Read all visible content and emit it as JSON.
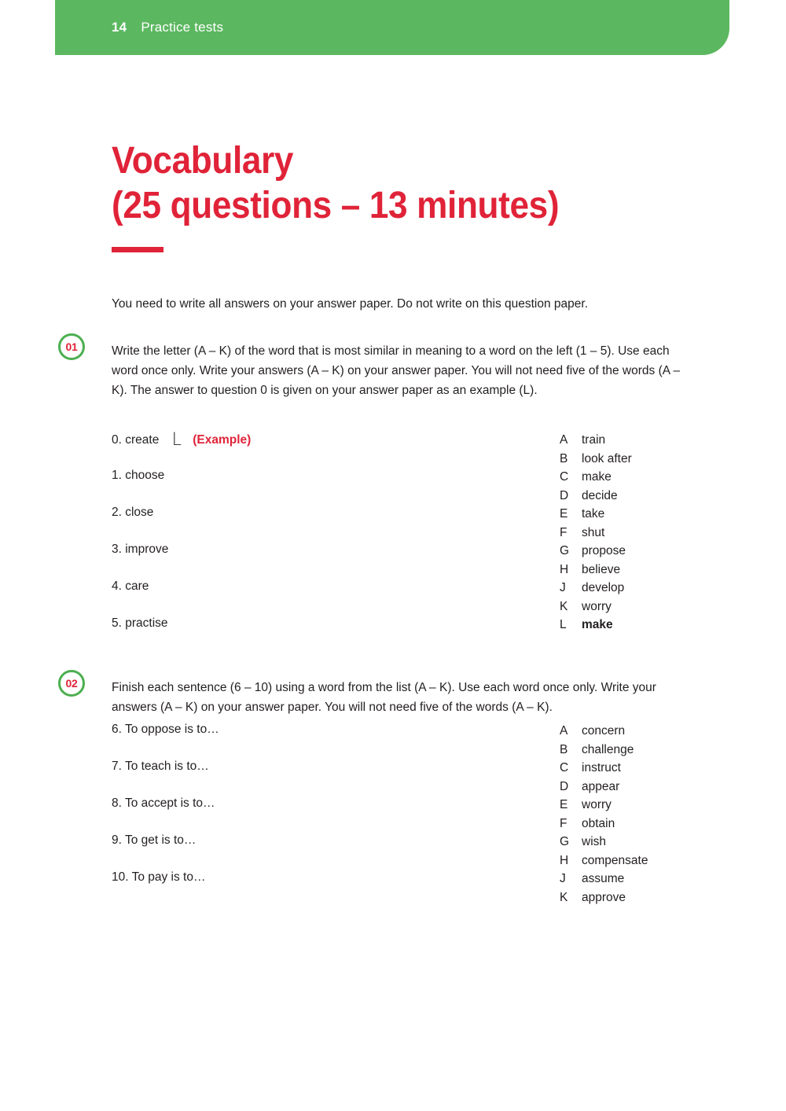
{
  "header": {
    "page_number": "14",
    "section_title": "Practice tests",
    "band_color": "#5cb860"
  },
  "title": {
    "line1": "Vocabulary",
    "line2": "(25 questions – 13 minutes)",
    "accent_color": "#e02338"
  },
  "instruction_note": "You need to write all answers on your answer paper. Do not write on this question paper.",
  "questions": [
    {
      "badge": "01",
      "prompt": "Write the letter (A – K) of the word that is most similar in meaning to a word on the left (1 – 5). Use each word once only. Write your answers (A – K) on your answer paper. You will not need five of the words (A – K). The answer to question 0 is given on your answer paper as an example (L).",
      "stems": [
        {
          "text": "0. create",
          "example_letter": "L",
          "example_tag": "(Example)"
        },
        {
          "text": "1. choose"
        },
        {
          "text": "2. close"
        },
        {
          "text": "3. improve"
        },
        {
          "text": "4. care"
        },
        {
          "text": "5. practise"
        }
      ],
      "options": [
        {
          "letter": "A",
          "word": "train",
          "bold": false
        },
        {
          "letter": "B",
          "word": "look after",
          "bold": false
        },
        {
          "letter": "C",
          "word": "make",
          "bold": false
        },
        {
          "letter": "D",
          "word": "decide",
          "bold": false
        },
        {
          "letter": "E",
          "word": "take",
          "bold": false
        },
        {
          "letter": "F",
          "word": "shut",
          "bold": false
        },
        {
          "letter": "G",
          "word": "propose",
          "bold": false
        },
        {
          "letter": "H",
          "word": "believe",
          "bold": false
        },
        {
          "letter": "J",
          "word": "develop",
          "bold": false
        },
        {
          "letter": "K",
          "word": "worry",
          "bold": false
        },
        {
          "letter": "L",
          "word": "make",
          "bold": true
        }
      ]
    },
    {
      "badge": "02",
      "prompt": "Finish each sentence (6 – 10) using a word from the list (A – K). Use each word once only. Write your answers (A – K) on your answer paper. You will not need five of the words (A – K).",
      "stems": [
        {
          "text": "6. To oppose is to…"
        },
        {
          "text": "7. To teach is to…"
        },
        {
          "text": "8. To accept is to…"
        },
        {
          "text": "9. To get is to…"
        },
        {
          "text": "10. To pay is to…"
        }
      ],
      "options": [
        {
          "letter": "A",
          "word": "concern",
          "bold": false
        },
        {
          "letter": "B",
          "word": "challenge",
          "bold": false
        },
        {
          "letter": "C",
          "word": "instruct",
          "bold": false
        },
        {
          "letter": "D",
          "word": "appear",
          "bold": false
        },
        {
          "letter": "E",
          "word": "worry",
          "bold": false
        },
        {
          "letter": "F",
          "word": "obtain",
          "bold": false
        },
        {
          "letter": "G",
          "word": "wish",
          "bold": false
        },
        {
          "letter": "H",
          "word": "compensate",
          "bold": false
        },
        {
          "letter": "J",
          "word": "assume",
          "bold": false
        },
        {
          "letter": "K",
          "word": "approve",
          "bold": false
        }
      ]
    }
  ]
}
